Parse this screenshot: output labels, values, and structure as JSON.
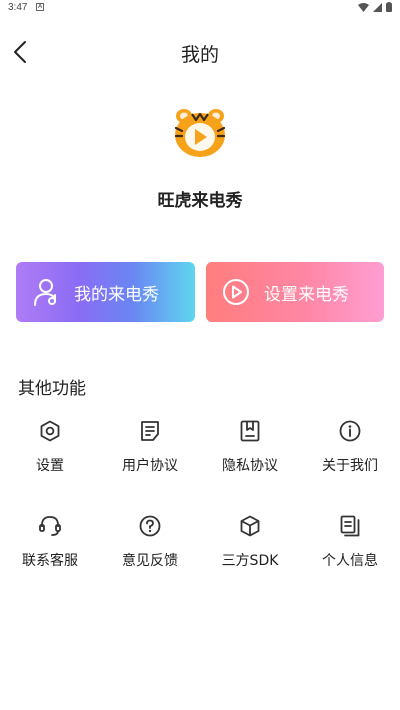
{
  "status": {
    "time": "3:47",
    "notif": "A"
  },
  "header": {
    "title": "我的"
  },
  "profile": {
    "app_name": "旺虎来电秀"
  },
  "cards": [
    {
      "label": "我的来电秀",
      "icon": "person-icon"
    },
    {
      "label": "设置来电秀",
      "icon": "play-circle-icon"
    }
  ],
  "section": {
    "title": "其他功能"
  },
  "grid": [
    {
      "label": "设置",
      "icon": "settings-hexagon-icon"
    },
    {
      "label": "用户协议",
      "icon": "document-icon"
    },
    {
      "label": "隐私协议",
      "icon": "bookmark-doc-icon"
    },
    {
      "label": "关于我们",
      "icon": "info-icon"
    },
    {
      "label": "联系客服",
      "icon": "headset-icon"
    },
    {
      "label": "意见反馈",
      "icon": "question-icon"
    },
    {
      "label": "三方SDK",
      "icon": "cube-icon"
    },
    {
      "label": "个人信息",
      "icon": "files-icon"
    }
  ],
  "colors": {
    "accent_orange": "#f7a21b",
    "card_left_start": "#b07cf6",
    "card_left_end": "#5fd6ee",
    "card_right_start": "#ff7d7d",
    "card_right_end": "#ff9ed3"
  }
}
